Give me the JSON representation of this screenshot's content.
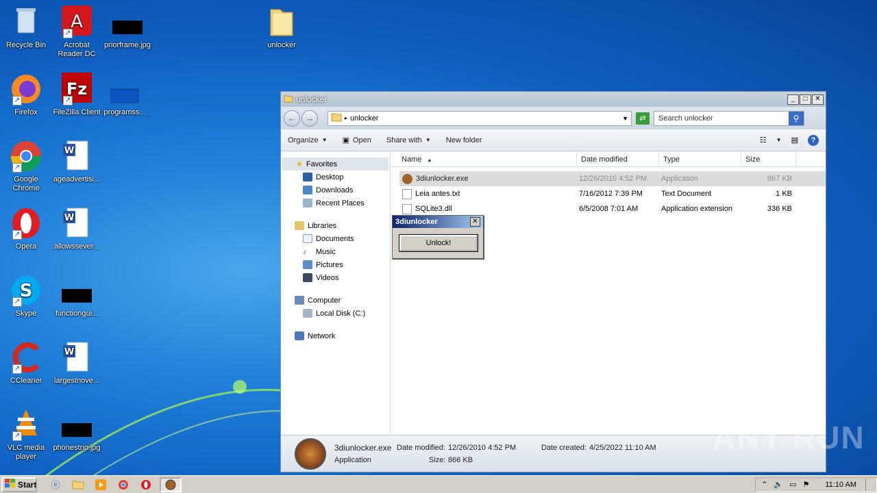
{
  "desktop": {
    "icons": [
      {
        "label": "Recycle Bin"
      },
      {
        "label": "Acrobat Reader DC"
      },
      {
        "label": "priorframe.jpg"
      },
      {
        "label": "unlocker"
      },
      {
        "label": "Firefox"
      },
      {
        "label": "FileZilla Client"
      },
      {
        "label": "programss..."
      },
      {
        "label": "Google Chrome"
      },
      {
        "label": "ageadvertisi..."
      },
      {
        "label": "Opera"
      },
      {
        "label": "allowssever..."
      },
      {
        "label": "Skype"
      },
      {
        "label": "functiongui..."
      },
      {
        "label": "CCleaner"
      },
      {
        "label": "largestnove..."
      },
      {
        "label": "VLC media player"
      },
      {
        "label": "phonestrip.jpg"
      }
    ]
  },
  "explorer": {
    "title": "unlocker",
    "address": "unlocker",
    "search_placeholder": "Search unlocker",
    "toolbar": {
      "organize": "Organize",
      "open": "Open",
      "share_with": "Share with",
      "new_folder": "New folder"
    },
    "nav": {
      "favorites": "Favorites",
      "desktop": "Desktop",
      "downloads": "Downloads",
      "recent_places": "Recent Places",
      "libraries": "Libraries",
      "documents": "Documents",
      "music": "Music",
      "pictures": "Pictures",
      "videos": "Videos",
      "computer": "Computer",
      "local_disk": "Local Disk (C:)",
      "network": "Network"
    },
    "columns": {
      "name": "Name",
      "date_modified": "Date modified",
      "type": "Type",
      "size": "Size"
    },
    "files": [
      {
        "name": "3diunlocker.exe",
        "date": "12/26/2010 4:52 PM",
        "type": "Application",
        "size": "867 KB"
      },
      {
        "name": "Leia antes.txt",
        "date": "7/16/2012 7:39 PM",
        "type": "Text Document",
        "size": "1 KB"
      },
      {
        "name": "SQLite3.dll",
        "date": "6/5/2008 7:01 AM",
        "type": "Application extension",
        "size": "336 KB"
      }
    ],
    "details": {
      "filename": "3diunlocker.exe",
      "kind": "Application",
      "date_modified_label": "Date modified:",
      "date_modified": "12/26/2010 4:52 PM",
      "size_label": "Size:",
      "size": "866 KB",
      "date_created_label": "Date created:",
      "date_created": "4/25/2022 11:10 AM"
    }
  },
  "popup": {
    "title": "3diunlocker",
    "button": "Unlock!"
  },
  "taskbar": {
    "start": "Start",
    "clock": "11:10 AM"
  },
  "watermark": "ANY RUN"
}
